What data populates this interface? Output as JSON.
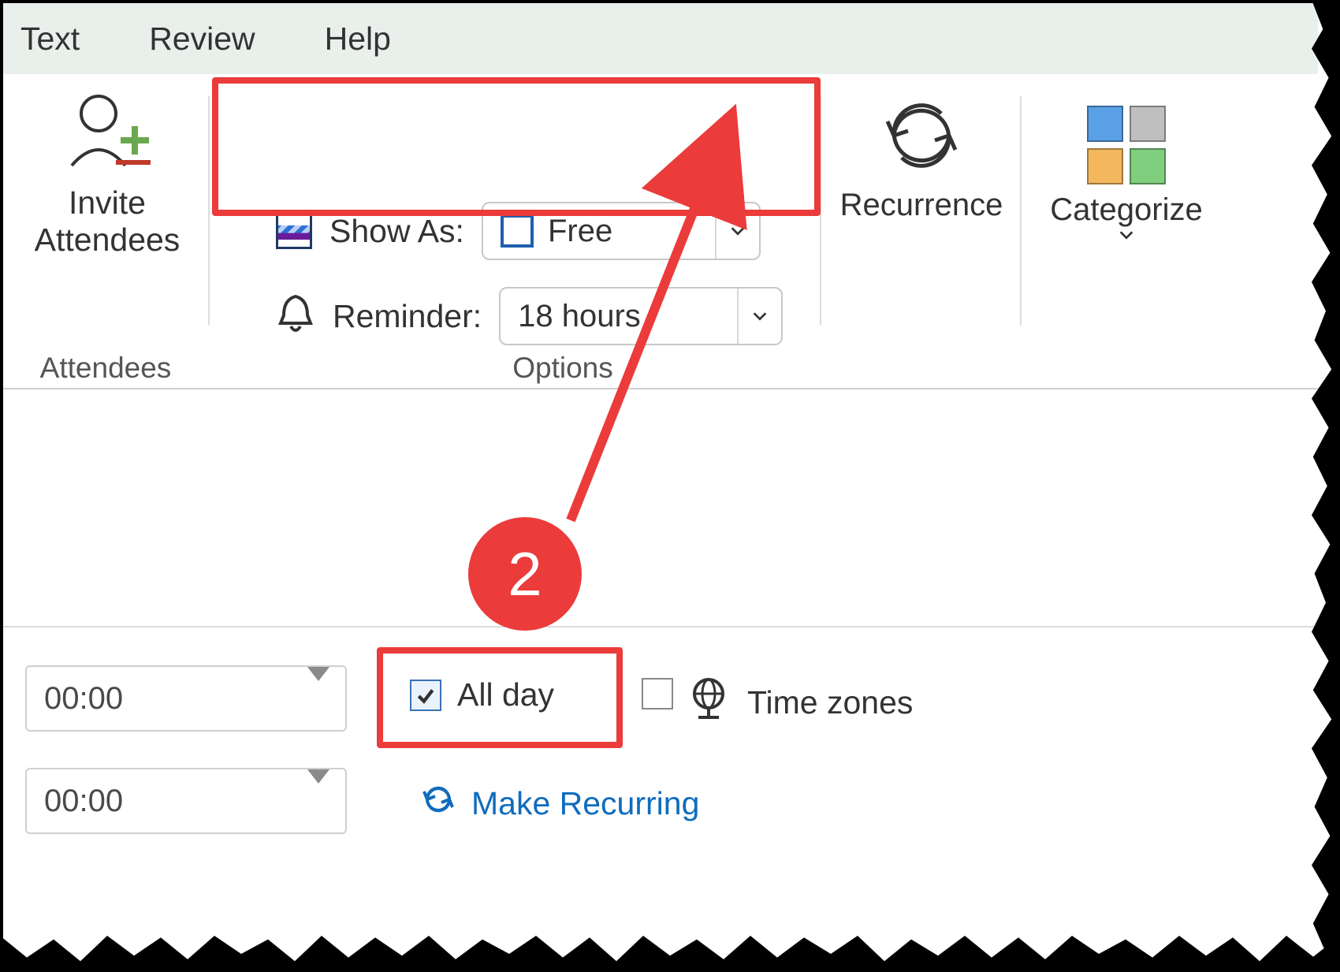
{
  "menubar": {
    "text": "Text",
    "review": "Review",
    "help": "Help"
  },
  "ribbon": {
    "attendees": {
      "button_label": "Invite\nAttendees",
      "group_caption": "Attendees"
    },
    "options": {
      "show_as_label": "Show As:",
      "show_as_value": "Free",
      "reminder_label": "Reminder:",
      "reminder_value": "18 hours",
      "group_caption": "Options"
    },
    "recurrence": {
      "label": "Recurrence"
    },
    "categorize": {
      "label": "Categorize"
    }
  },
  "body": {
    "start_time": "00:00",
    "end_time": "00:00",
    "all_day_label": "All day",
    "all_day_checked": true,
    "time_zones_label": "Time zones",
    "make_recurring_label": "Make Recurring"
  },
  "annotation": {
    "step_number": "2"
  }
}
